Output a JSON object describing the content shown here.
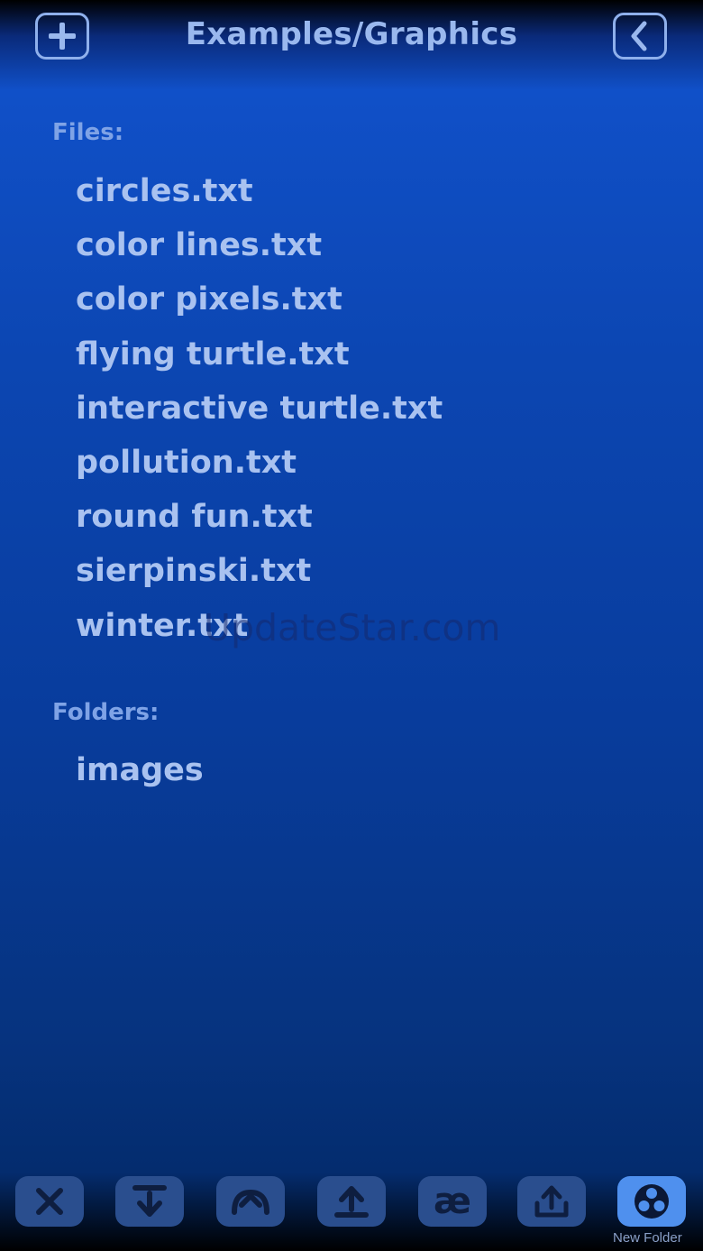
{
  "header": {
    "title": "Examples/Graphics",
    "add_icon": "plus-icon",
    "back_icon": "chevron-left-icon"
  },
  "files": {
    "label": "Files:",
    "items": [
      "circles.txt",
      "color lines.txt",
      "color pixels.txt",
      "flying turtle.txt",
      "interactive turtle.txt",
      "pollution.txt",
      "round fun.txt",
      "sierpinski.txt",
      "winter.txt"
    ]
  },
  "folders": {
    "label": "Folders:",
    "items": [
      "images"
    ]
  },
  "watermark": "UpdateStar.com",
  "toolbar": {
    "buttons": [
      {
        "icon": "close-icon"
      },
      {
        "icon": "download-icon"
      },
      {
        "icon": "arch-icon"
      },
      {
        "icon": "upload-icon"
      },
      {
        "icon": "ae-ligature-icon",
        "glyph": "æ"
      },
      {
        "icon": "share-icon"
      },
      {
        "icon": "new-folder-icon"
      }
    ],
    "active_caption": "New Folder"
  },
  "colors": {
    "text": "#a9c2f0",
    "label": "#7fa3e6",
    "active_button": "#4f90ee"
  }
}
